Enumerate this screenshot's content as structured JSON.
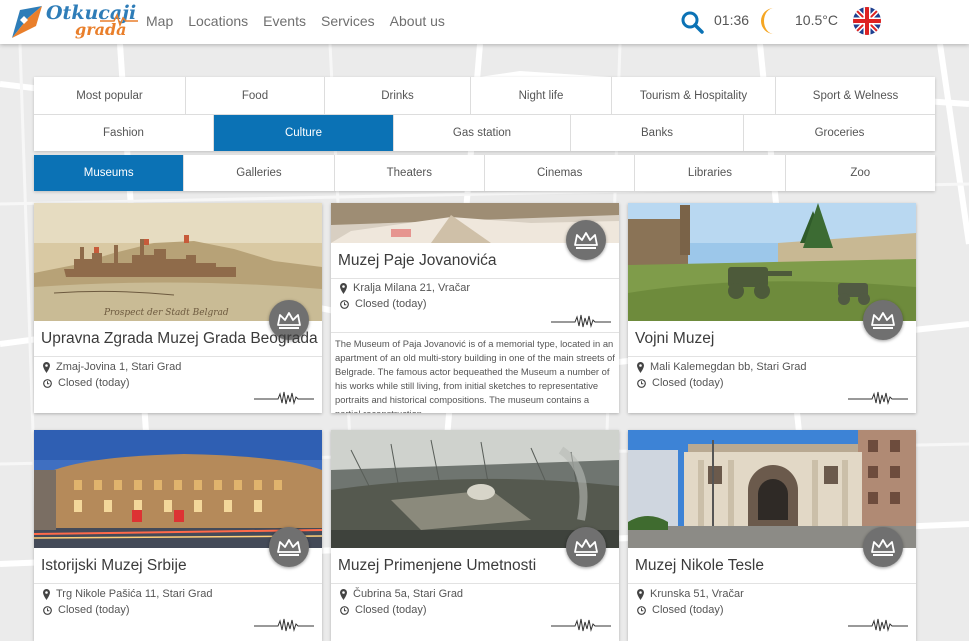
{
  "header": {
    "logo_line1": "Otkucaji",
    "logo_line2": "grada",
    "nav": [
      "Map",
      "Locations",
      "Events",
      "Services",
      "About us"
    ],
    "time": "01:36",
    "temperature": "10.5°C",
    "icons": {
      "search": "search-icon",
      "weather": "moon-icon",
      "language": "uk-flag-icon"
    }
  },
  "categories": {
    "row1": [
      "Most popular",
      "Food",
      "Drinks",
      "Night life",
      "Tourism & Hospitality",
      "Sport & Welness"
    ],
    "row2": [
      "Fashion",
      "Culture",
      "Gas station",
      "Banks",
      "Groceries"
    ],
    "active": "Culture"
  },
  "subcategories": {
    "items": [
      "Museums",
      "Galleries",
      "Theaters",
      "Cinemas",
      "Libraries",
      "Zoo"
    ],
    "active": "Museums"
  },
  "cards": [
    {
      "title": "Upravna Zgrada Muzej Grada Beograda",
      "address": "Zmaj-Jovina 1, Stari Grad",
      "status": "Closed (today)",
      "image": "old-city-engraving"
    },
    {
      "title": "Muzej Paje Jovanovića",
      "address": "Kralja Milana 21, Vračar",
      "status": "Closed (today)",
      "description": "The Museum of Paja Jovanović is of a memorial type, located in an apartment of an old multi-story building in one of the main streets of Belgrade. The famous actor bequeathed the Museum a number of his works while still living, from initial sketches to representative portraits and historical compositions. The museum contains a partial reconstruction",
      "image": "painting-detail"
    },
    {
      "title": "Vojni Muzej",
      "address": "Mali Kalemegdan bb, Stari Grad",
      "status": "Closed (today)",
      "image": "fortress-cannons"
    },
    {
      "title": "Istorijski Muzej Srbije",
      "address": "Trg Nikole Pašića 11, Stari Grad",
      "status": "Closed (today)",
      "image": "historic-building-dusk"
    },
    {
      "title": "Muzej Primenjene Umetnosti",
      "address": "Čubrina 5a, Stari Grad",
      "status": "Closed (today)",
      "image": "exhibition-hall"
    },
    {
      "title": "Muzej Nikole Tesle",
      "address": "Krunska 51, Vračar",
      "status": "Closed (today)",
      "image": "villa-facade"
    }
  ],
  "colors": {
    "accent": "#0b72b5",
    "logo_blue": "#2e7db8",
    "logo_orange": "#e97f2b",
    "moon": "#f5a623"
  }
}
